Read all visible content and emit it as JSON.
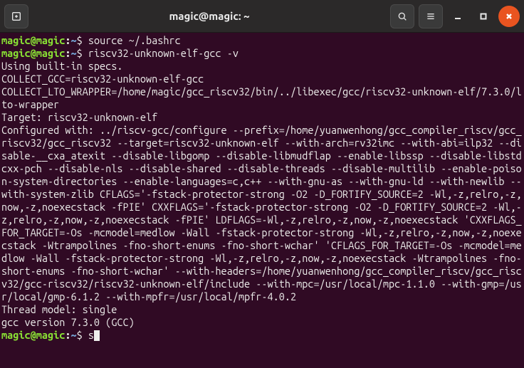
{
  "titlebar": {
    "title": "magic@magic: ~"
  },
  "terminal": {
    "lines": [
      {
        "type": "prompt",
        "user": "magic@magic",
        "path": "~",
        "cmd": "source ~/.bashrc"
      },
      {
        "type": "prompt",
        "user": "magic@magic",
        "path": "~",
        "cmd": "riscv32-unknown-elf-gcc -v"
      },
      {
        "type": "out",
        "text": "Using built-in specs."
      },
      {
        "type": "out",
        "text": "COLLECT_GCC=riscv32-unknown-elf-gcc"
      },
      {
        "type": "out",
        "text": "COLLECT_LTO_WRAPPER=/home/magic/gcc_riscv32/bin/../libexec/gcc/riscv32-unknown-elf/7.3.0/lto-wrapper"
      },
      {
        "type": "out",
        "text": "Target: riscv32-unknown-elf"
      },
      {
        "type": "out",
        "text": "Configured with: ../riscv-gcc/configure --prefix=/home/yuanwenhong/gcc_compiler_riscv/gcc_riscv32/gcc_riscv32 --target=riscv32-unknown-elf --with-arch=rv32imc --with-abi=ilp32 --disable-__cxa_atexit --disable-libgomp --disable-libmudflap --enable-libssp --disable-libstdcxx-pch --disable-nls --disable-shared --disable-threads --disable-multilib --enable-poison-system-directories --enable-languages=c,c++ --with-gnu-as --with-gnu-ld --with-newlib --with-system-zlib CFLAGS='-fstack-protector-strong -O2 -D_FORTIFY_SOURCE=2 -Wl,-z,relro,-z,now,-z,noexecstack -fPIE' CXXFLAGS='-fstack-protector-strong -O2 -D_FORTIFY_SOURCE=2 -Wl,-z,relro,-z,now,-z,noexecstack -fPIE' LDFLAGS=-Wl,-z,relro,-z,now,-z,noexecstack 'CXXFLAGS_FOR_TARGET=-Os -mcmodel=medlow -Wall -fstack-protector-strong -Wl,-z,relro,-z,now,-z,noexecstack -Wtrampolines -fno-short-enums -fno-short-wchar' 'CFLAGS_FOR_TARGET=-Os -mcmodel=medlow -Wall -fstack-protector-strong -Wl,-z,relro,-z,now,-z,noexecstack -Wtrampolines -fno-short-enums -fno-short-wchar' --with-headers=/home/yuanwenhong/gcc_compiler_riscv/gcc_riscv32/gcc-riscv32/riscv32-unknown-elf/include --with-mpc=/usr/local/mpc-1.1.0 --with-gmp=/usr/local/gmp-6.1.2 --with-mpfr=/usr/local/mpfr-4.0.2"
      },
      {
        "type": "out",
        "text": "Thread model: single"
      },
      {
        "type": "out",
        "text": "gcc version 7.3.0 (GCC)"
      },
      {
        "type": "prompt",
        "user": "magic@magic",
        "path": "~",
        "cmd": "s",
        "cursor": true
      }
    ]
  }
}
